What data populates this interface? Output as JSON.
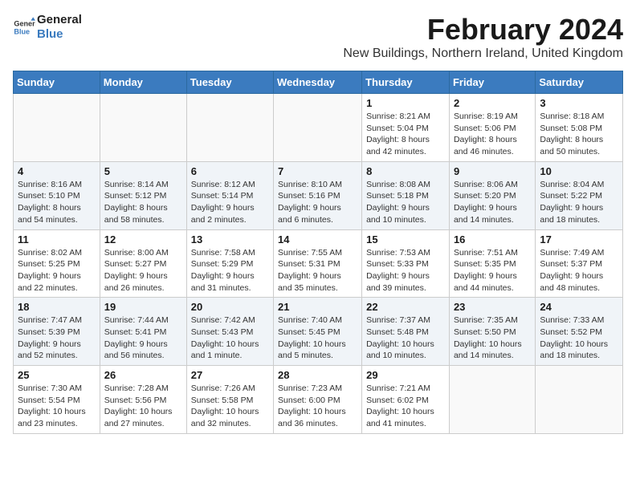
{
  "app": {
    "logo_line1": "General",
    "logo_line2": "Blue"
  },
  "header": {
    "title": "February 2024",
    "subtitle": "New Buildings, Northern Ireland, United Kingdom"
  },
  "calendar": {
    "days_of_week": [
      "Sunday",
      "Monday",
      "Tuesday",
      "Wednesday",
      "Thursday",
      "Friday",
      "Saturday"
    ],
    "weeks": [
      [
        {
          "day": "",
          "info": ""
        },
        {
          "day": "",
          "info": ""
        },
        {
          "day": "",
          "info": ""
        },
        {
          "day": "",
          "info": ""
        },
        {
          "day": "1",
          "info": "Sunrise: 8:21 AM\nSunset: 5:04 PM\nDaylight: 8 hours\nand 42 minutes."
        },
        {
          "day": "2",
          "info": "Sunrise: 8:19 AM\nSunset: 5:06 PM\nDaylight: 8 hours\nand 46 minutes."
        },
        {
          "day": "3",
          "info": "Sunrise: 8:18 AM\nSunset: 5:08 PM\nDaylight: 8 hours\nand 50 minutes."
        }
      ],
      [
        {
          "day": "4",
          "info": "Sunrise: 8:16 AM\nSunset: 5:10 PM\nDaylight: 8 hours\nand 54 minutes."
        },
        {
          "day": "5",
          "info": "Sunrise: 8:14 AM\nSunset: 5:12 PM\nDaylight: 8 hours\nand 58 minutes."
        },
        {
          "day": "6",
          "info": "Sunrise: 8:12 AM\nSunset: 5:14 PM\nDaylight: 9 hours\nand 2 minutes."
        },
        {
          "day": "7",
          "info": "Sunrise: 8:10 AM\nSunset: 5:16 PM\nDaylight: 9 hours\nand 6 minutes."
        },
        {
          "day": "8",
          "info": "Sunrise: 8:08 AM\nSunset: 5:18 PM\nDaylight: 9 hours\nand 10 minutes."
        },
        {
          "day": "9",
          "info": "Sunrise: 8:06 AM\nSunset: 5:20 PM\nDaylight: 9 hours\nand 14 minutes."
        },
        {
          "day": "10",
          "info": "Sunrise: 8:04 AM\nSunset: 5:22 PM\nDaylight: 9 hours\nand 18 minutes."
        }
      ],
      [
        {
          "day": "11",
          "info": "Sunrise: 8:02 AM\nSunset: 5:25 PM\nDaylight: 9 hours\nand 22 minutes."
        },
        {
          "day": "12",
          "info": "Sunrise: 8:00 AM\nSunset: 5:27 PM\nDaylight: 9 hours\nand 26 minutes."
        },
        {
          "day": "13",
          "info": "Sunrise: 7:58 AM\nSunset: 5:29 PM\nDaylight: 9 hours\nand 31 minutes."
        },
        {
          "day": "14",
          "info": "Sunrise: 7:55 AM\nSunset: 5:31 PM\nDaylight: 9 hours\nand 35 minutes."
        },
        {
          "day": "15",
          "info": "Sunrise: 7:53 AM\nSunset: 5:33 PM\nDaylight: 9 hours\nand 39 minutes."
        },
        {
          "day": "16",
          "info": "Sunrise: 7:51 AM\nSunset: 5:35 PM\nDaylight: 9 hours\nand 44 minutes."
        },
        {
          "day": "17",
          "info": "Sunrise: 7:49 AM\nSunset: 5:37 PM\nDaylight: 9 hours\nand 48 minutes."
        }
      ],
      [
        {
          "day": "18",
          "info": "Sunrise: 7:47 AM\nSunset: 5:39 PM\nDaylight: 9 hours\nand 52 minutes."
        },
        {
          "day": "19",
          "info": "Sunrise: 7:44 AM\nSunset: 5:41 PM\nDaylight: 9 hours\nand 56 minutes."
        },
        {
          "day": "20",
          "info": "Sunrise: 7:42 AM\nSunset: 5:43 PM\nDaylight: 10 hours\nand 1 minute."
        },
        {
          "day": "21",
          "info": "Sunrise: 7:40 AM\nSunset: 5:45 PM\nDaylight: 10 hours\nand 5 minutes."
        },
        {
          "day": "22",
          "info": "Sunrise: 7:37 AM\nSunset: 5:48 PM\nDaylight: 10 hours\nand 10 minutes."
        },
        {
          "day": "23",
          "info": "Sunrise: 7:35 AM\nSunset: 5:50 PM\nDaylight: 10 hours\nand 14 minutes."
        },
        {
          "day": "24",
          "info": "Sunrise: 7:33 AM\nSunset: 5:52 PM\nDaylight: 10 hours\nand 18 minutes."
        }
      ],
      [
        {
          "day": "25",
          "info": "Sunrise: 7:30 AM\nSunset: 5:54 PM\nDaylight: 10 hours\nand 23 minutes."
        },
        {
          "day": "26",
          "info": "Sunrise: 7:28 AM\nSunset: 5:56 PM\nDaylight: 10 hours\nand 27 minutes."
        },
        {
          "day": "27",
          "info": "Sunrise: 7:26 AM\nSunset: 5:58 PM\nDaylight: 10 hours\nand 32 minutes."
        },
        {
          "day": "28",
          "info": "Sunrise: 7:23 AM\nSunset: 6:00 PM\nDaylight: 10 hours\nand 36 minutes."
        },
        {
          "day": "29",
          "info": "Sunrise: 7:21 AM\nSunset: 6:02 PM\nDaylight: 10 hours\nand 41 minutes."
        },
        {
          "day": "",
          "info": ""
        },
        {
          "day": "",
          "info": ""
        }
      ]
    ]
  }
}
